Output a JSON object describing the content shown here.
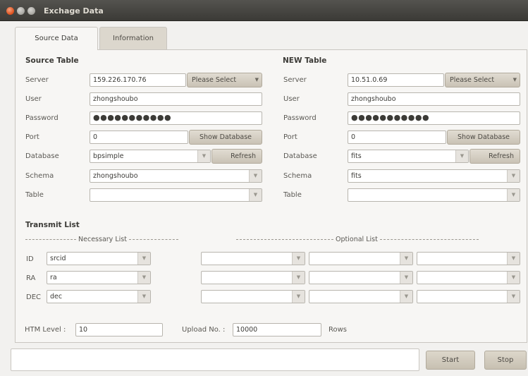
{
  "window": {
    "title": "Exchage Data"
  },
  "tabs": [
    {
      "label": "Source Data",
      "active": true
    },
    {
      "label": "Information",
      "active": false
    }
  ],
  "source": {
    "heading": "Source Table",
    "server_label": "Server",
    "server": "159.226.170.76",
    "server_select": "Please Select",
    "user_label": "User",
    "user": "zhongshoubo",
    "password_label": "Password",
    "password": "●●●●●●●●●●●",
    "port_label": "Port",
    "port": "0",
    "show_db": "Show Database",
    "database_label": "Database",
    "database": "bpsimple",
    "refresh": "Refresh",
    "schema_label": "Schema",
    "schema": "zhongshoubo",
    "table_label": "Table",
    "table": ""
  },
  "target": {
    "heading": "NEW Table",
    "server_label": "Server",
    "server": "10.51.0.69",
    "server_select": "Please Select",
    "user_label": "User",
    "user": "zhongshoubo",
    "password_label": "Password",
    "password": "●●●●●●●●●●●",
    "port_label": "Port",
    "port": "0",
    "show_db": "Show Database",
    "database_label": "Database",
    "database": "fits",
    "refresh": "Refresh",
    "schema_label": "Schema",
    "schema": "fits",
    "table_label": "Table",
    "table": ""
  },
  "transmit": {
    "heading": "Transmit List",
    "necessary_label": "Necessary List",
    "optional_label": "Optional List",
    "rows": [
      {
        "label": "ID",
        "value": "srcid"
      },
      {
        "label": "RA",
        "value": "ra"
      },
      {
        "label": "DEC",
        "value": "dec"
      }
    ]
  },
  "params": {
    "htm_label": "HTM Level :",
    "htm_value": "10",
    "upload_label": "Upload No. :",
    "upload_value": "10000",
    "rows_label": "Rows"
  },
  "actions": {
    "start": "Start",
    "stop": "Stop"
  },
  "colors": {
    "titlebar": "#3b3a36",
    "close": "#e0531f",
    "button": "#c9c2b5"
  }
}
